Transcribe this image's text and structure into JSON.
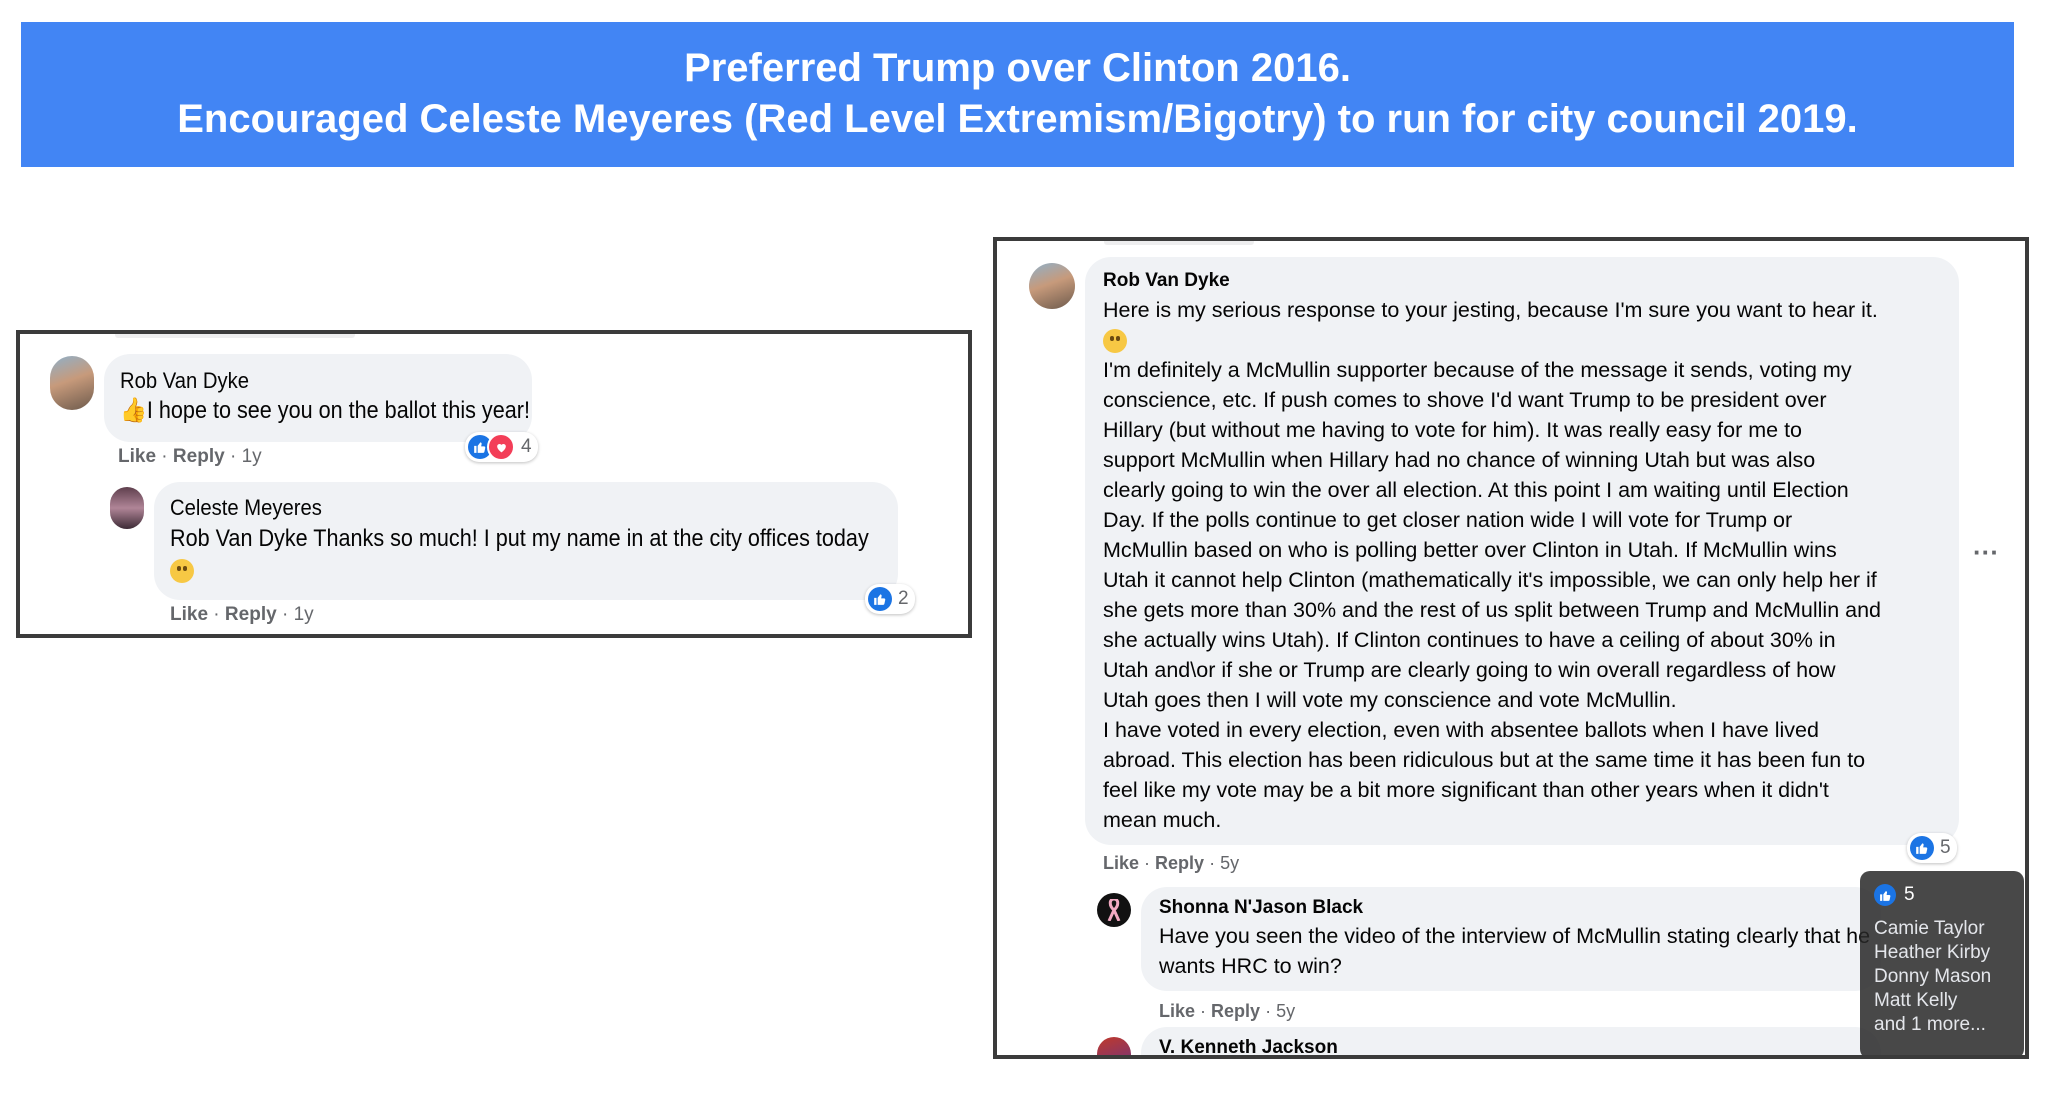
{
  "banner": {
    "line1": "Preferred Trump over Clinton 2016.",
    "line2": "Encouraged Celeste Meyeres (Red Level Extremism/Bigotry) to run for city council 2019."
  },
  "left_panel": {
    "comment1": {
      "author": "Rob Van Dyke",
      "text": "I hope to see you on the ballot this year!",
      "like_label": "Like",
      "reply_label": "Reply",
      "age": "1y",
      "reaction_count": "4"
    },
    "reply1": {
      "author": "Celeste Meyeres",
      "mention": "Rob Van Dyke",
      "text": "Thanks so much! I put my name in at the city offices today",
      "like_label": "Like",
      "reply_label": "Reply",
      "age": "1y",
      "reaction_count": "2"
    }
  },
  "right_panel": {
    "comment": {
      "author": "Rob Van Dyke",
      "line1": "Here is my serious response to your jesting, because I'm sure you want to hear it.",
      "body": [
        "I'm definitely a McMullin supporter because of the message it sends, voting my",
        "conscience, etc. If push comes to shove I'd want Trump to be president over",
        "Hillary (but without me having to vote for him). It was really easy for me to",
        "support McMullin when Hillary had no chance of winning Utah but was also",
        "clearly going to win the over all election. At this point I am waiting until Election",
        "Day. If the polls continue to get closer nation wide I will vote for Trump or",
        "McMullin based on who is polling better over Clinton in Utah. If McMullin wins",
        "Utah it cannot help Clinton (mathematically it's impossible, we can only help her if",
        "she gets more than 30% and the rest of us split between Trump and McMullin and",
        "she actually wins Utah). If Clinton continues to have a ceiling of about 30% in",
        "Utah and\\or if she or Trump are clearly going to win overall regardless of how",
        "Utah goes then I will vote my conscience and vote McMullin.",
        "I have voted in every election, even with absentee ballots when I have lived",
        "abroad. This election has been ridiculous but at the same time it has been fun to",
        "feel like my vote may be a bit more significant than other years when it didn't",
        "mean much."
      ],
      "like_label": "Like",
      "reply_label": "Reply",
      "age": "5y",
      "reaction_count": "5",
      "more_icon": "···"
    },
    "reply": {
      "author": "Shonna N'Jason Black",
      "line1": "Have you seen the video of the interview of McMullin stating clearly that he",
      "line2": "wants HRC to win?",
      "like_label": "Like",
      "reply_label": "Reply",
      "age": "5y"
    },
    "next_author": "V. Kenneth Jackson",
    "tooltip": {
      "count": "5",
      "names": [
        "Camie Taylor",
        "Heather Kirby",
        "Donny Mason",
        "Matt Kelly",
        "and 1 more..."
      ]
    }
  },
  "colors": {
    "banner": "#4285f4",
    "like": "#1b74e4",
    "love": "#f33e58",
    "bubble": "#f0f2f5",
    "meta": "#65676b"
  }
}
